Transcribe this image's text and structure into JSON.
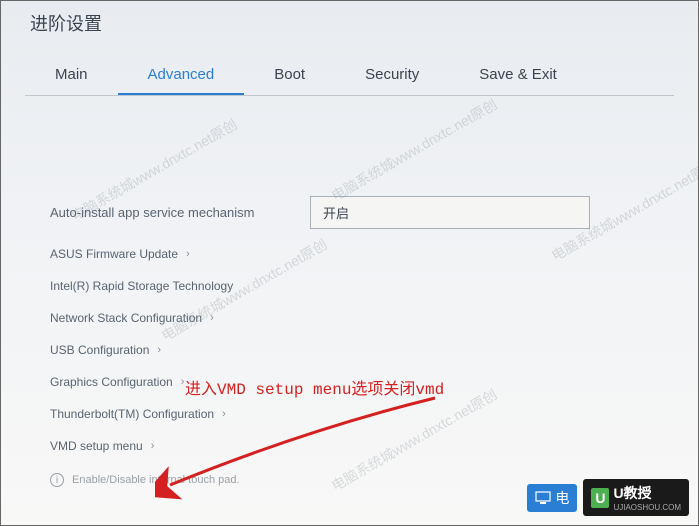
{
  "title": "进阶设置",
  "tabs": [
    {
      "label": "Main"
    },
    {
      "label": "Advanced"
    },
    {
      "label": "Boot"
    },
    {
      "label": "Security"
    },
    {
      "label": "Save & Exit"
    }
  ],
  "active_tab": 1,
  "setting": {
    "label": "Auto-install app service mechanism",
    "value": "开启"
  },
  "menu_items": [
    {
      "label": "ASUS Firmware Update"
    },
    {
      "label": "Intel(R) Rapid Storage Technology"
    },
    {
      "label": "Network Stack Configuration"
    },
    {
      "label": "USB Configuration"
    },
    {
      "label": "Graphics Configuration"
    },
    {
      "label": "Thunderbolt(TM) Configuration"
    },
    {
      "label": "VMD setup menu"
    }
  ],
  "hint": "Enable/Disable internal touch pad.",
  "annotation": "进入VMD setup menu选项关闭vmd",
  "watermark": "电脑系统城www.dnxtc.net原创",
  "logo1_text": "电",
  "logo2": {
    "green": "U",
    "main": "U教授",
    "sub": "UJIAOSHOU.COM"
  }
}
